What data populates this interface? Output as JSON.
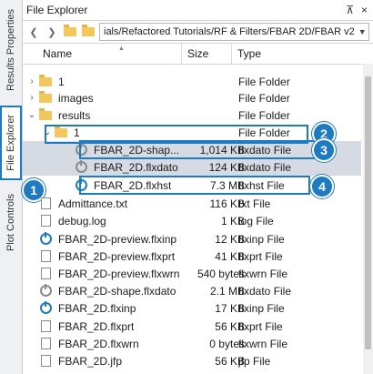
{
  "sidebar": {
    "tabs": [
      {
        "label": "Results Properties"
      },
      {
        "label": "File Explorer"
      },
      {
        "label": "Plot Controls"
      }
    ]
  },
  "panel": {
    "title": "File Explorer",
    "pin_glyph": "⊼",
    "close_glyph": "×",
    "path": "ials/Refactored Tutorials/RF & Filters/FBAR 2D/FBAR v2"
  },
  "columns": {
    "name": "Name",
    "size": "Size",
    "type": "Type"
  },
  "files": [
    {
      "twisty": "›",
      "icon": "folder",
      "name": "1",
      "size": "",
      "type": "File Folder"
    },
    {
      "twisty": "›",
      "icon": "folder",
      "name": "images",
      "size": "",
      "type": "File Folder"
    },
    {
      "twisty": "⌄",
      "icon": "folder",
      "name": "results",
      "size": "",
      "type": "File Folder"
    },
    {
      "twisty": "⌄",
      "icon": "folder",
      "name": "1",
      "size": "",
      "type": "File Folder"
    },
    {
      "twisty": "",
      "icon": "power-grey",
      "name": "FBAR_2D-shap...",
      "size": "1,014 KB",
      "type": "flxdato File"
    },
    {
      "twisty": "",
      "icon": "power-grey",
      "name": "FBAR_2D.flxdato",
      "size": "124 KB",
      "type": "flxdato File"
    },
    {
      "twisty": "",
      "icon": "power-blue",
      "name": "FBAR_2D.flxhst",
      "size": "7.3 MB",
      "type": "flxhst File"
    },
    {
      "twisty": "",
      "icon": "doc",
      "name": "Admittance.txt",
      "size": "116 KB",
      "type": "txt File"
    },
    {
      "twisty": "",
      "icon": "doc",
      "name": "debug.log",
      "size": "1 KB",
      "type": "log File"
    },
    {
      "twisty": "",
      "icon": "power-blue",
      "name": "FBAR_2D-preview.flxinp",
      "size": "12 KB",
      "type": "flxinp File"
    },
    {
      "twisty": "",
      "icon": "doc",
      "name": "FBAR_2D-preview.flxprt",
      "size": "41 KB",
      "type": "flxprt File"
    },
    {
      "twisty": "",
      "icon": "doc",
      "name": "FBAR_2D-preview.flxwrn",
      "size": "540 bytes",
      "type": "flxwrn File"
    },
    {
      "twisty": "",
      "icon": "power-grey",
      "name": "FBAR_2D-shape.flxdato",
      "size": "2.1 MB",
      "type": "flxdato File"
    },
    {
      "twisty": "",
      "icon": "power-blue",
      "name": "FBAR_2D.flxinp",
      "size": "17 KB",
      "type": "flxinp File"
    },
    {
      "twisty": "",
      "icon": "doc",
      "name": "FBAR_2D.flxprt",
      "size": "56 KB",
      "type": "flxprt File"
    },
    {
      "twisty": "",
      "icon": "doc",
      "name": "FBAR_2D.flxwrn",
      "size": "0 bytes",
      "type": "flxwrn File"
    },
    {
      "twisty": "",
      "icon": "doc",
      "name": "FBAR_2D.jfp",
      "size": "56 KB",
      "type": "jfp File"
    }
  ],
  "badges": [
    "1",
    "2",
    "3",
    "4"
  ],
  "colors": {
    "accent": "#1e7ac1",
    "selection": "#d6dbe3"
  }
}
